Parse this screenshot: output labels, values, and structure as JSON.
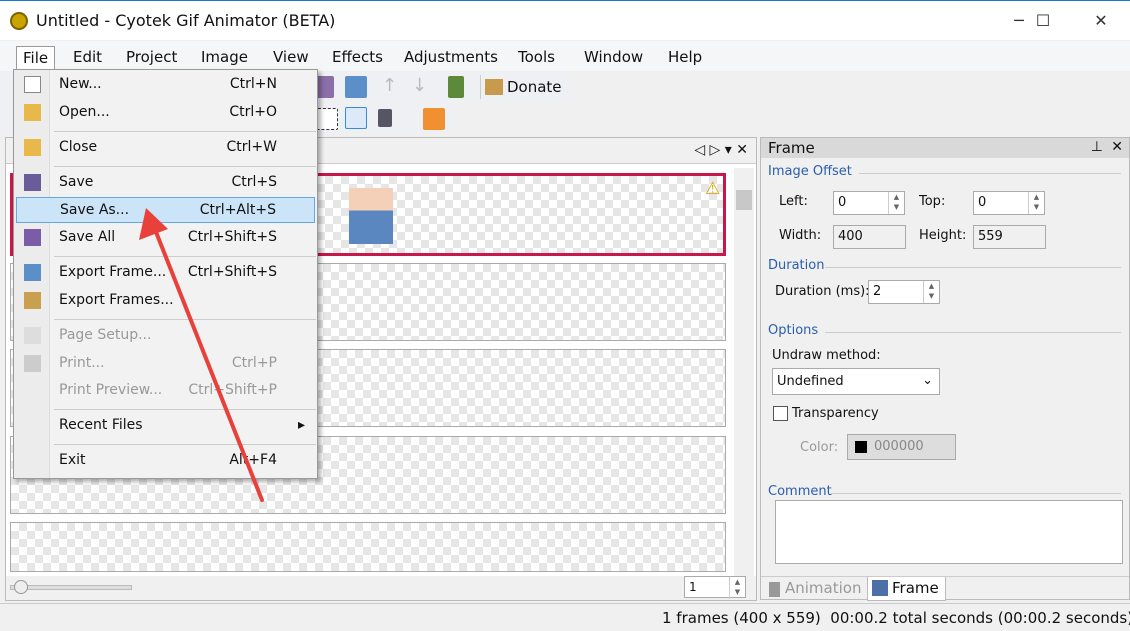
{
  "window": {
    "title": "Untitled - Cyotek Gif Animator (BETA)",
    "minimize": "─",
    "maximize": "☐",
    "close": "✕"
  },
  "menubar": [
    "File",
    "Edit",
    "Project",
    "Image",
    "View",
    "Effects",
    "Adjustments",
    "Tools",
    "Window",
    "Help"
  ],
  "toolbar": {
    "donate": "Donate"
  },
  "file_menu": {
    "items": [
      {
        "label": "New...",
        "shortcut": "Ctrl+N"
      },
      {
        "label": "Open...",
        "shortcut": "Ctrl+O"
      },
      {
        "label": "Close",
        "shortcut": "Ctrl+W"
      },
      {
        "label": "Save",
        "shortcut": "Ctrl+S"
      },
      {
        "label": "Save As...",
        "shortcut": "Ctrl+Alt+S"
      },
      {
        "label": "Save All",
        "shortcut": "Ctrl+Shift+S"
      },
      {
        "label": "Export Frame...",
        "shortcut": "Ctrl+Shift+S"
      },
      {
        "label": "Export Frames...",
        "shortcut": ""
      },
      {
        "label": "Page Setup...",
        "shortcut": ""
      },
      {
        "label": "Print...",
        "shortcut": "Ctrl+P"
      },
      {
        "label": "Print Preview...",
        "shortcut": "Ctrl+Shift+P"
      },
      {
        "label": "Recent Files",
        "shortcut": "▸"
      },
      {
        "label": "Exit",
        "shortcut": "Alt+F4"
      }
    ]
  },
  "document": {
    "nav": "◁ ▷ ▾ ✕",
    "frame_number": "1",
    "warning": "⚠"
  },
  "frame_panel": {
    "title": "Frame",
    "pin": "⊥",
    "close": "✕",
    "image_offset": "Image Offset",
    "left_label": "Left:",
    "left": "0",
    "top_label": "Top:",
    "top": "0",
    "width_label": "Width:",
    "width": "400",
    "height_label": "Height:",
    "height": "559",
    "duration_section": "Duration",
    "duration_label": "Duration (ms):",
    "duration": "2",
    "options": "Options",
    "undraw_label": "Undraw method:",
    "undraw": "Undefined",
    "transparency": "Transparency",
    "color_label": "Color:",
    "color": "000000",
    "comment": "Comment",
    "tabs": [
      "Animation",
      "Frame"
    ]
  },
  "status": "1 frames (400 x 559)  00:00.2 total seconds (00:00.2 seconds)",
  "colors": {
    "accent": "#2a5db0",
    "selected_frame": "#c8174a",
    "annotation": "#e8403a"
  }
}
